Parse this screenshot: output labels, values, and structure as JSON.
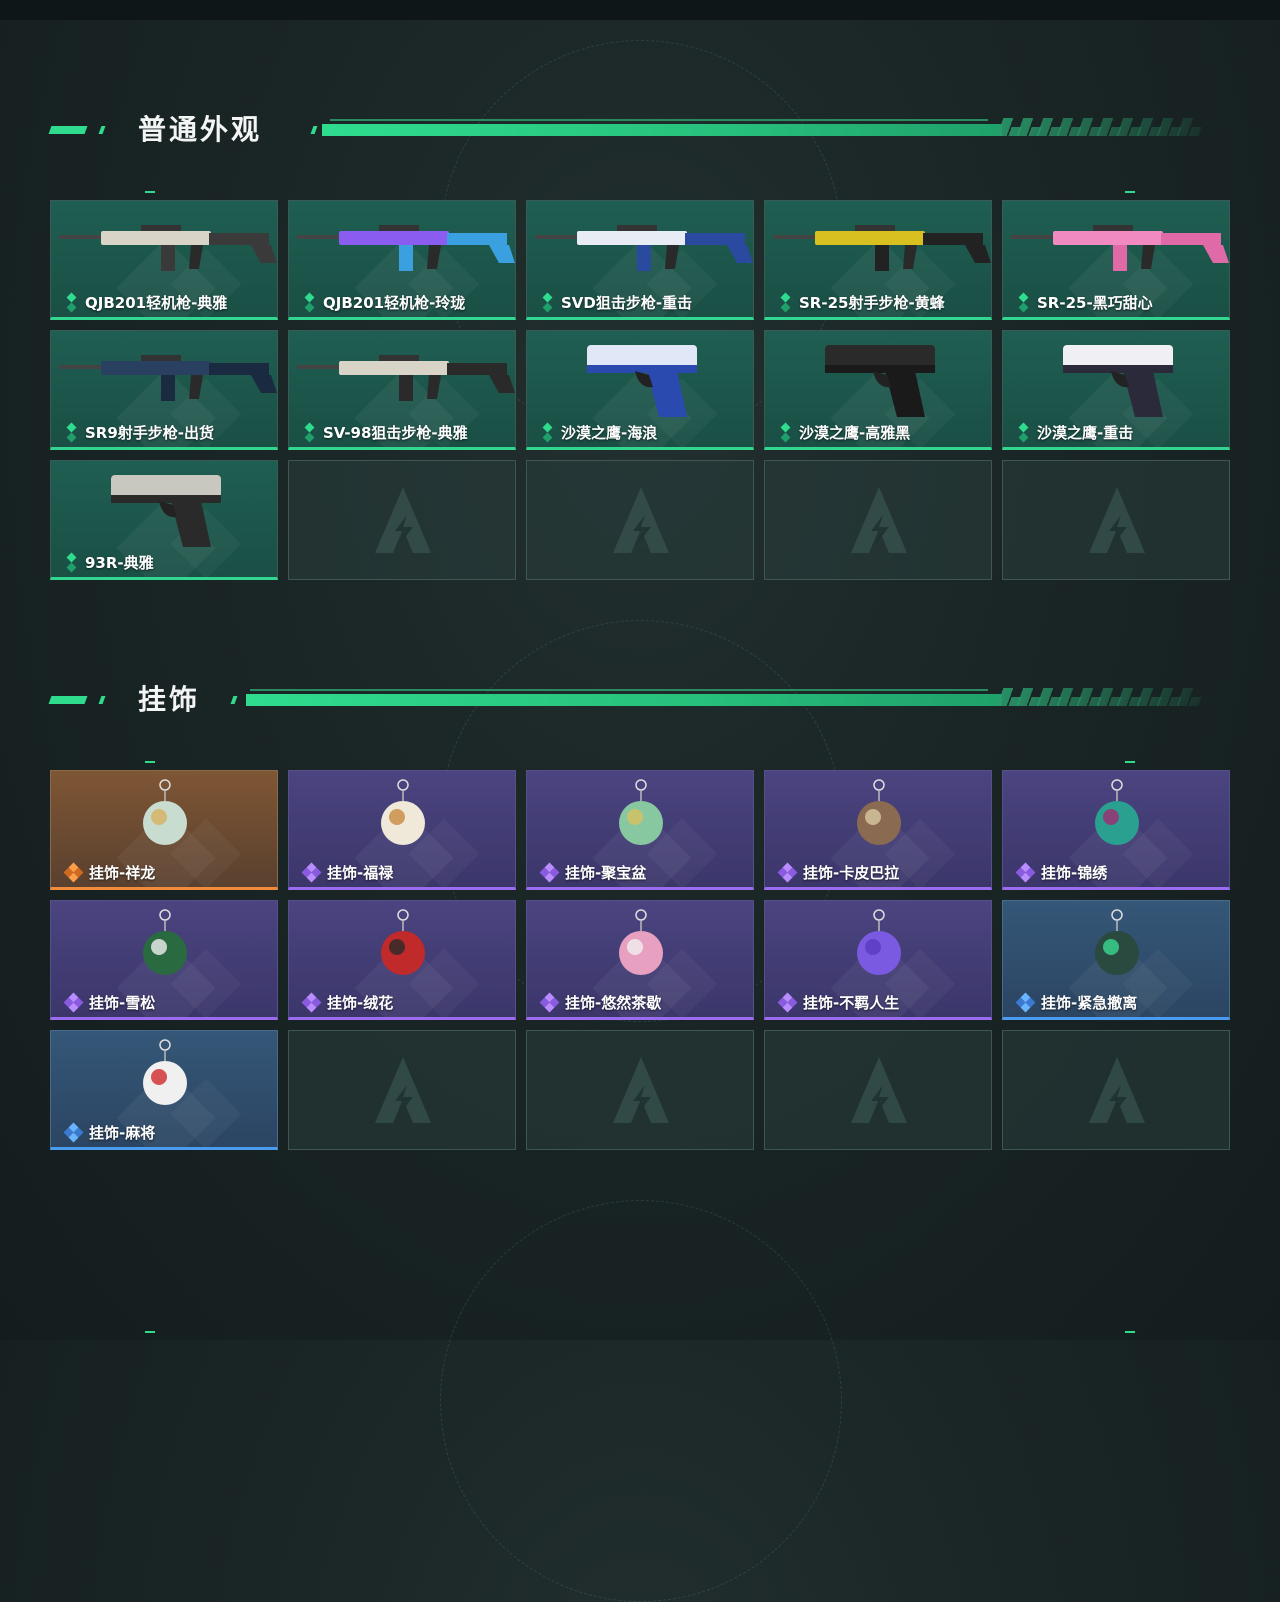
{
  "colors": {
    "accent_green": "#2fdc8e",
    "rarity_green": "#33d68f",
    "rarity_purple": "#9b6cf0",
    "rarity_orange": "#f08c3c",
    "rarity_blue": "#4a9cf0"
  },
  "sections": [
    {
      "title": "普通外观",
      "items": [
        {
          "label": "QJB201轻机枪-典雅",
          "rarity": "green",
          "icon": "light-machine-gun-icon"
        },
        {
          "label": "QJB201轻机枪-玲珑",
          "rarity": "green",
          "icon": "light-machine-gun-icon"
        },
        {
          "label": "SVD狙击步枪-重击",
          "rarity": "green",
          "icon": "sniper-rifle-icon"
        },
        {
          "label": "SR-25射手步枪-黄蜂",
          "rarity": "green",
          "icon": "marksman-rifle-icon"
        },
        {
          "label": "SR-25-黑巧甜心",
          "rarity": "green",
          "icon": "marksman-rifle-icon"
        },
        {
          "label": "SR9射手步枪-出货",
          "rarity": "green",
          "icon": "marksman-rifle-icon"
        },
        {
          "label": "SV-98狙击步枪-典雅",
          "rarity": "green",
          "icon": "sniper-rifle-icon"
        },
        {
          "label": "沙漠之鹰-海浪",
          "rarity": "green",
          "icon": "pistol-icon"
        },
        {
          "label": "沙漠之鹰-高雅黑",
          "rarity": "green",
          "icon": "pistol-icon"
        },
        {
          "label": "沙漠之鹰-重击",
          "rarity": "green",
          "icon": "pistol-icon"
        },
        {
          "label": "93R-典雅",
          "rarity": "green",
          "icon": "pistol-icon"
        }
      ]
    },
    {
      "title": "挂饰",
      "items": [
        {
          "label": "挂饰-祥龙",
          "rarity": "orange",
          "icon": "dragon-charm-icon"
        },
        {
          "label": "挂饰-福禄",
          "rarity": "purple",
          "icon": "gourd-charm-icon"
        },
        {
          "label": "挂饰-聚宝盆",
          "rarity": "purple",
          "icon": "treasure-bowl-charm-icon"
        },
        {
          "label": "挂饰-卡皮巴拉",
          "rarity": "purple",
          "icon": "capybara-charm-icon"
        },
        {
          "label": "挂饰-锦绣",
          "rarity": "purple",
          "icon": "butterfly-charm-icon"
        },
        {
          "label": "挂饰-雪松",
          "rarity": "purple",
          "icon": "pine-tree-charm-icon"
        },
        {
          "label": "挂饰-绒花",
          "rarity": "purple",
          "icon": "rose-charm-icon"
        },
        {
          "label": "挂饰-悠然茶歇",
          "rarity": "purple",
          "icon": "cupcake-charm-icon"
        },
        {
          "label": "挂饰-不羁人生",
          "rarity": "purple",
          "icon": "sneaker-charm-icon"
        },
        {
          "label": "挂饰-紧急撤离",
          "rarity": "blue",
          "icon": "emergency-sign-charm-icon"
        },
        {
          "label": "挂饰-麻将",
          "rarity": "blue",
          "icon": "mahjong-tile-charm-icon"
        }
      ]
    }
  ]
}
